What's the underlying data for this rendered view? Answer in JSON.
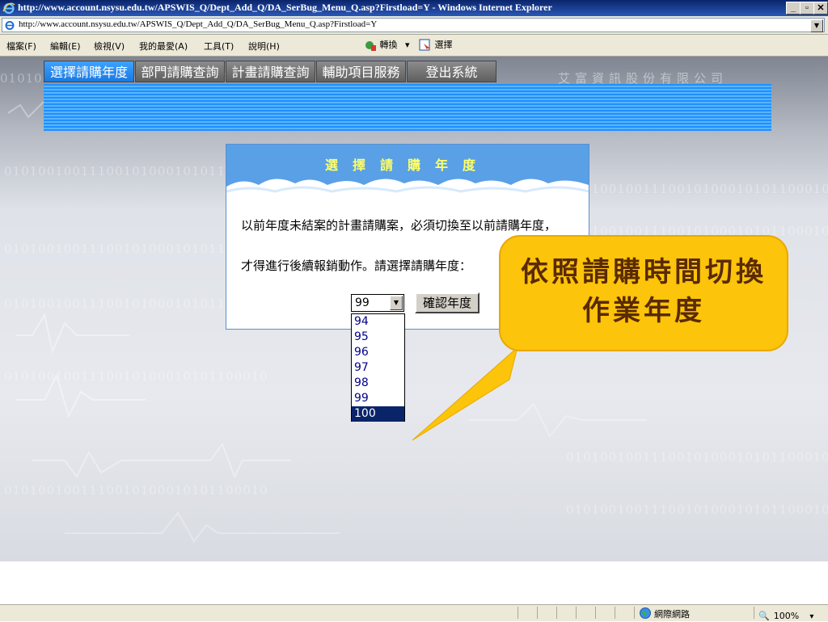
{
  "window": {
    "title": "http://www.account.nsysu.edu.tw/APSWIS_Q/Dept_Add_Q/DA_SerBug_Menu_Q.asp?Firstload=Y - Windows Internet Explorer",
    "min_glyph": "_",
    "max_glyph": "▫",
    "close_glyph": "✕"
  },
  "address": {
    "url": "http://www.account.nsysu.edu.tw/APSWIS_Q/Dept_Add_Q/DA_SerBug_Menu_Q.asp?Firstload=Y"
  },
  "menu": {
    "items": [
      "檔案(F)",
      "編輯(E)",
      "檢視(V)",
      "我的最愛(A)",
      "工具(T)",
      "說明(H)"
    ],
    "convert_label": "轉換",
    "select_label": "選擇"
  },
  "nav": {
    "tabs": [
      "選擇請購年度",
      "部門請購查詢",
      "計畫請購查詢",
      "輔助項目服務",
      "登出系統"
    ],
    "active_index": 0,
    "company": "艾富資訊股份有限公司",
    "bg_pattern": "0101001001110010100010101100010"
  },
  "dialog": {
    "title": "選擇請購年度",
    "line1": "以前年度未結案的計畫請購案，必須切換至以前請購年度，",
    "line2": "才得進行後續報銷動作。請選擇請購年度：",
    "selected_year": "99",
    "confirm_label": "確認年度"
  },
  "dropdown": {
    "options": [
      "94",
      "95",
      "96",
      "97",
      "98",
      "99",
      "100"
    ],
    "highlighted": "100"
  },
  "callout": {
    "line1": "依照請購時間切換",
    "line2": "作業年度"
  },
  "status": {
    "zone": "網際網路",
    "zoom": "100%"
  },
  "colors": {
    "title_bar": "#0a246a",
    "active_tab": "#1a78e0",
    "banner": "#1e90ff",
    "callout": "#fcc40a",
    "highlight": "#0a246a"
  }
}
